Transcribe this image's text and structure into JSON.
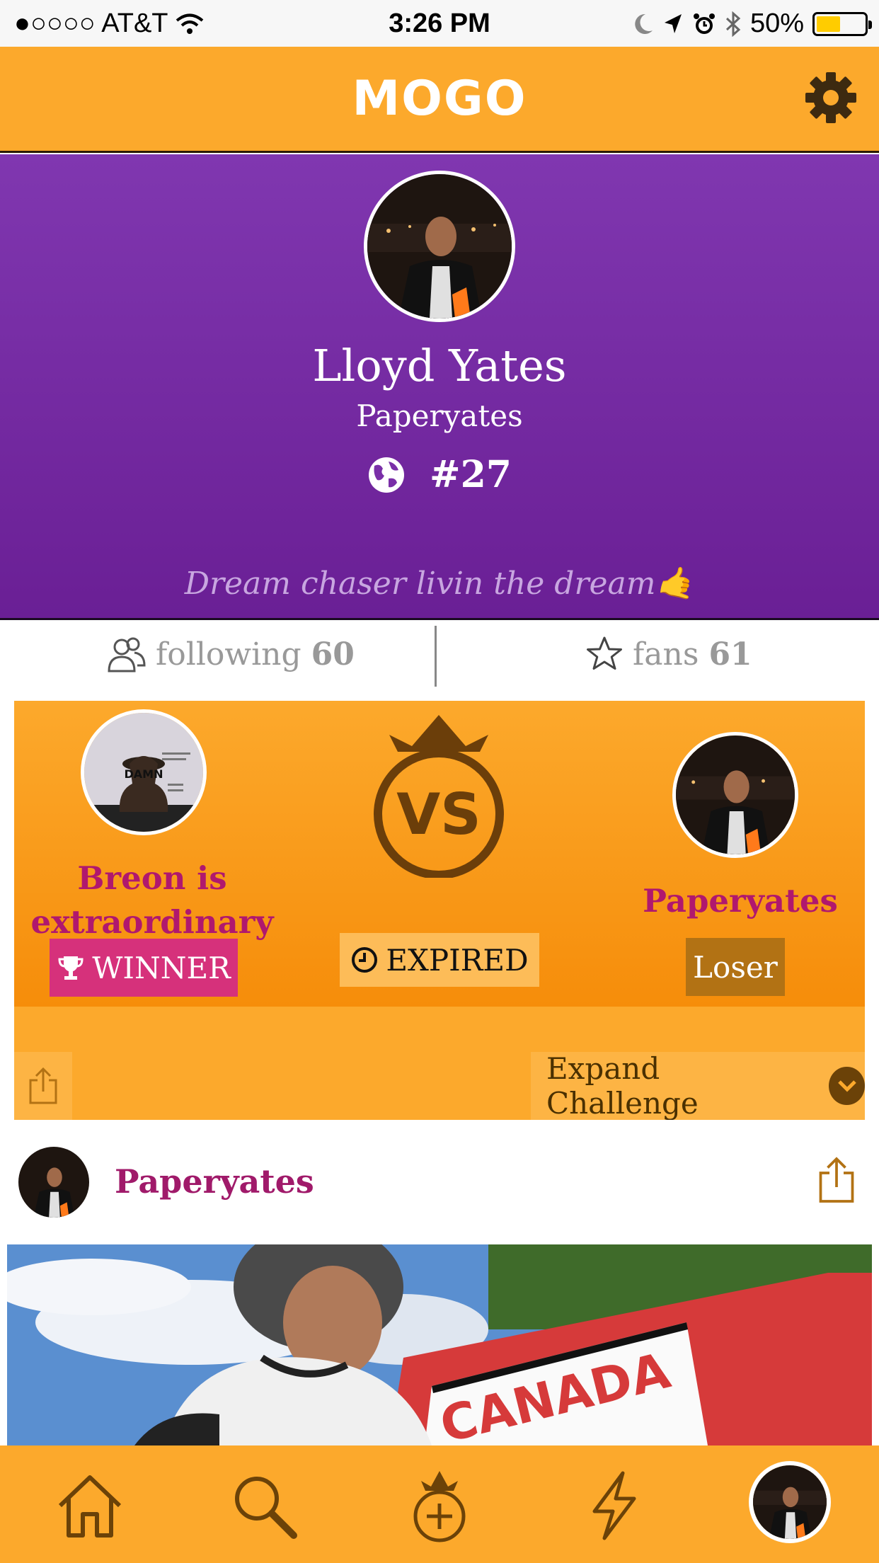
{
  "status_bar": {
    "carrier": "●○○○○ AT&T",
    "time": "3:26 PM",
    "battery": "50%"
  },
  "app": {
    "logo": "MOGO"
  },
  "profile": {
    "name": "Lloyd Yates",
    "username": "Paperyates",
    "rank": "#27",
    "bio": "Dream chaser livin the dream🤙"
  },
  "stats": {
    "following_label": "following",
    "following_count": "60",
    "fans_label": "fans",
    "fans_count": "61"
  },
  "challenge": {
    "left_name": "Breon is extraordinary",
    "left_result": "WINNER",
    "status": "EXPIRED",
    "vs": "VS",
    "right_name": "Paperyates",
    "right_result": "Loser",
    "expand_label": "Expand Challenge"
  },
  "post": {
    "username": "Paperyates",
    "media_sign_text": "CANADA"
  },
  "colors": {
    "orange": "#fca92c",
    "purple": "#7a2fa8",
    "magenta": "#b0186e",
    "winner_pink": "#d6317b",
    "loser_brown": "#b27214"
  }
}
